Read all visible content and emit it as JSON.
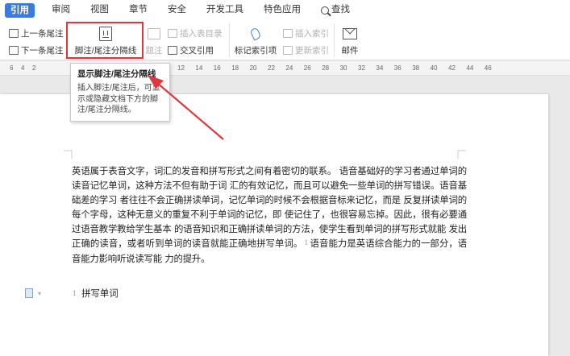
{
  "tabs": [
    {
      "label": "引用",
      "active": true
    },
    {
      "label": "审阅"
    },
    {
      "label": "视图"
    },
    {
      "label": "章节"
    },
    {
      "label": "安全"
    },
    {
      "label": "开发工具"
    },
    {
      "label": "特色应用"
    }
  ],
  "search_label": "查找",
  "toolbar": {
    "prev_note": "上一条尾注",
    "next_note": "下一条尾注",
    "footnote_separator": "脚注/尾注分隔线",
    "insert_table_index": "插入表目录",
    "caption": "题注",
    "cross_reference": "交叉引用",
    "mark_index_entry": "标记索引项",
    "insert_index": "插入索引",
    "update_index": "更新索引",
    "mail": "邮件"
  },
  "ruler_ticks": [
    "6",
    "4",
    "2",
    "12",
    "14",
    "16",
    "18",
    "20",
    "22",
    "24",
    "26",
    "28",
    "30",
    "32",
    "34",
    "36",
    "38",
    "40",
    "42",
    "44",
    "46"
  ],
  "tooltip": {
    "title": "显示脚注/尾注分隔线",
    "body": "插入脚注/尾注后，可显示或隐藏文档下方的脚注/尾注分隔线。"
  },
  "document": {
    "paragraph_part1": "英语属于表音文字，词汇的发音和拼写形式之间有着密切的联系。 语音基础好的学习者通过单词的读音记忆单词，这种方法不但有助于词 汇的有效记忆，而且可以避免一些单词的拼写错误。语音基础差的学习 者往往不会正确拼读单词，记忆单词的时候不会根据音标来记忆，而是 反复拼读单词的每个字母，这种无意义的重复不利于单词的记忆，即 使记住了，也很容易忘掉。因此，很有必要通过语音教学教给学生基本 的语音知识和正确拼读单词的方法，使学生看到单词的拼写形式就能 发出正确的读音，或者听到单词的读音就能正确地拼写单词。",
    "footnote_ref": "1",
    "paragraph_part2": "语音能力是英语综合能力的一部分，语音能力影响听说读写能 力的提升。",
    "footnote_number": "1",
    "footnote_text": "拼写单词"
  },
  "colors": {
    "accent": "#3a7be0",
    "annotation": "#e0383a"
  }
}
